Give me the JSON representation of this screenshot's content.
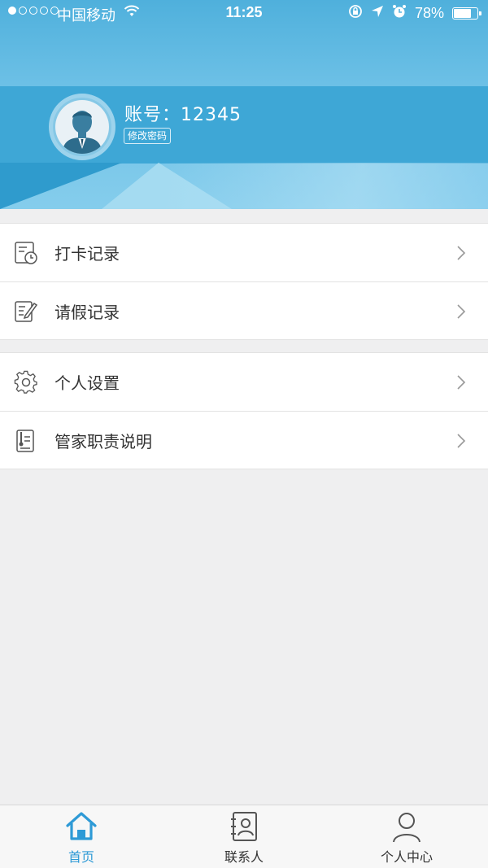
{
  "status_bar": {
    "carrier": "中国移动",
    "time": "11:25",
    "battery": "78%",
    "battery_level": 0.78,
    "signal_bars": 1
  },
  "profile": {
    "account": "账号：12345",
    "change_password": "修改密码"
  },
  "menu_groups": [
    [
      {
        "label": "打卡记录",
        "icon": "clock-in-record-icon"
      },
      {
        "label": "请假记录",
        "icon": "leave-record-icon"
      }
    ],
    [
      {
        "label": "个人设置",
        "icon": "gear-icon"
      },
      {
        "label": "管家职责说明",
        "icon": "document-icon"
      }
    ]
  ],
  "tabbar": {
    "tabs": [
      {
        "label": "首页",
        "icon": "home-icon",
        "active": true
      },
      {
        "label": "联系人",
        "icon": "contacts-icon",
        "active": false
      },
      {
        "label": "个人中心",
        "icon": "person-icon",
        "active": false
      }
    ]
  },
  "colors": {
    "accent": "#2e9ad6",
    "banner": "#4fb0dc",
    "background": "#efeff0"
  }
}
